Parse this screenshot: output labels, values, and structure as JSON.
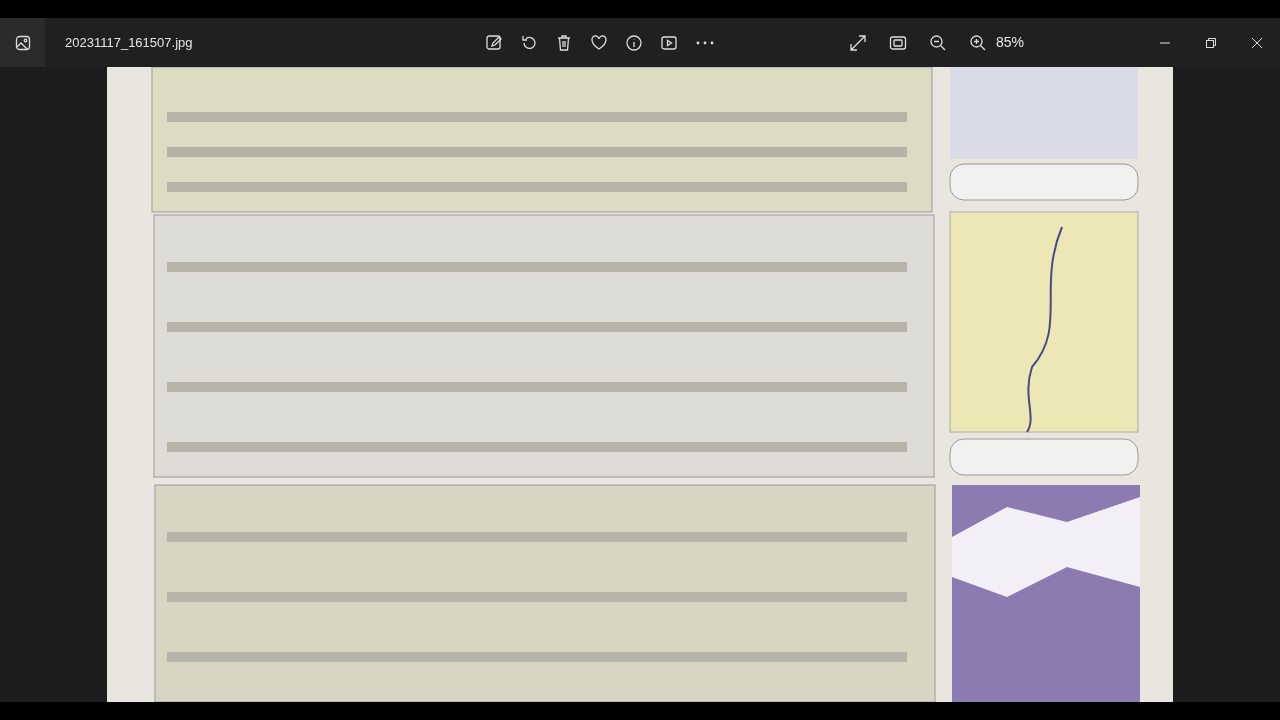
{
  "window": {
    "title": "20231117_161507.jpg"
  },
  "toolbar": {
    "zoom": "85%"
  }
}
